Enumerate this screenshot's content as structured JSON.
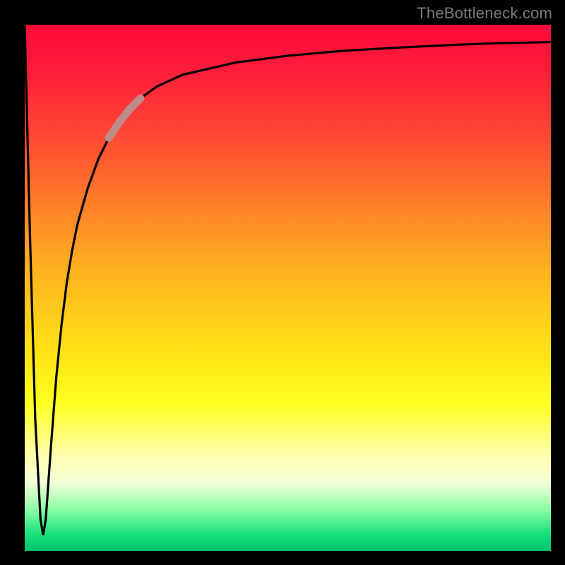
{
  "attribution": "TheBottleneck.com",
  "colors": {
    "frame": "#000000",
    "curve_stroke": "#000000",
    "highlight_stroke": "#c08a88",
    "gradient_top": "#ff0a3a",
    "gradient_bottom": "#00c46a"
  },
  "chart_data": {
    "type": "line",
    "title": "",
    "xlabel": "",
    "ylabel": "",
    "xlim": [
      0,
      100
    ],
    "ylim": [
      0,
      100
    ],
    "grid": false,
    "legend": false,
    "series": [
      {
        "name": "bottleneck-curve",
        "x": [
          0,
          1,
          2,
          3,
          3.5,
          4,
          5,
          6,
          7,
          8,
          9,
          10,
          12,
          14,
          16,
          18,
          20,
          22,
          25,
          30,
          40,
          50,
          60,
          70,
          80,
          90,
          100
        ],
        "values": [
          100,
          60,
          25,
          6,
          3,
          6,
          20,
          33,
          43,
          51,
          57,
          62,
          69,
          74.5,
          78.5,
          81.5,
          84,
          86,
          88.2,
          90.5,
          92.8,
          94.1,
          95.0,
          95.6,
          96.1,
          96.5,
          96.7
        ]
      }
    ],
    "highlight_segment": {
      "series": "bottleneck-curve",
      "x_start": 16,
      "x_end": 22
    }
  }
}
